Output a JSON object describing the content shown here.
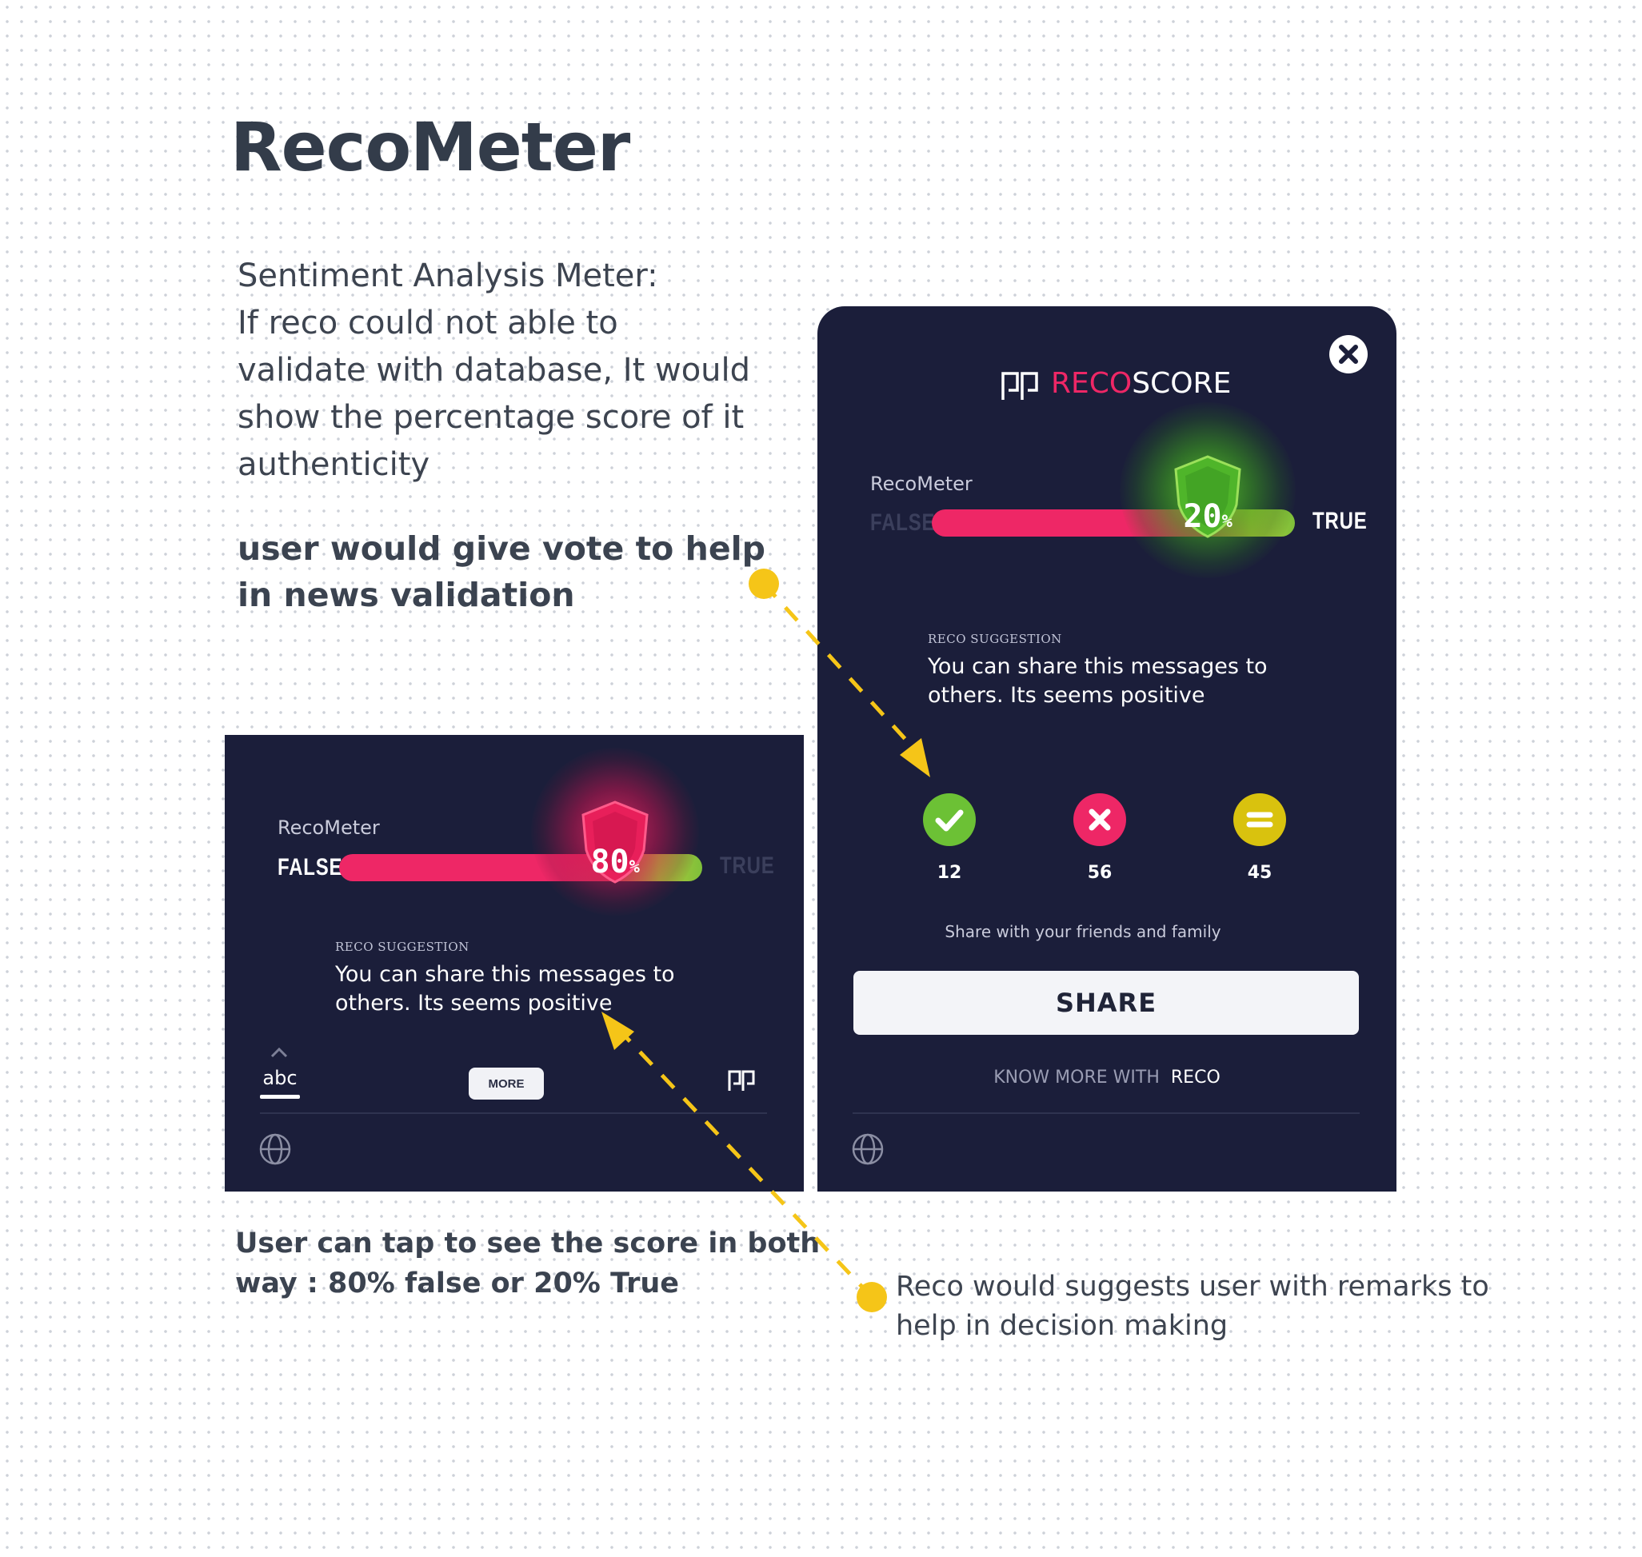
{
  "title": "RecoMeter",
  "description": [
    "Sentiment Analysis  Meter:",
    "If  reco  could not able to",
    "validate with database, It would",
    "show the percentage score of it",
    "authenticity"
  ],
  "vote_note": [
    "user would give vote to help",
    "in news validation"
  ],
  "tap_note": [
    "User can tap to see the score in both",
    "way : 80% false or 20% True"
  ],
  "reco_note": [
    "Reco would suggests user with remarks to",
    "help in decision making"
  ],
  "colors": {
    "panel": "#1b1e3a",
    "pink": "#ee2766",
    "green": "#6cc135",
    "yellow": "#f5c518",
    "annotation": "#f5c518"
  },
  "small_panel": {
    "meter_label": "RecoMeter",
    "false_label": "FALSE",
    "true_label": "TRUE",
    "score_value": "80",
    "score_unit": "%",
    "score_percent": 80,
    "suggestion_title": "RECO SUGGESTION",
    "suggestion_text": [
      "You can share this messages to",
      "others. Its seems positive"
    ],
    "keyboard_label": "abc",
    "more_label": "MORE",
    "icons": [
      "chevron-up-icon",
      "reco-logo-icon",
      "globe-icon"
    ]
  },
  "large_panel": {
    "brand_highlight": "RECO",
    "brand_rest": "SCORE",
    "meter_label": "RecoMeter",
    "false_label": "FALSE",
    "true_label": "TRUE",
    "score_value": "20",
    "score_unit": "%",
    "score_percent": 20,
    "suggestion_title": "RECO SUGGESTION",
    "suggestion_text": [
      "You can share this messages to",
      "others. Its seems positive"
    ],
    "votes": [
      {
        "icon": "check-icon",
        "count": "12",
        "color": "#6cc135"
      },
      {
        "icon": "cross-icon",
        "count": "56",
        "color": "#ee2766"
      },
      {
        "icon": "equals-icon",
        "count": "45",
        "color": "#d9c20e"
      }
    ],
    "share_hint": "Share with your friends and family",
    "share_label": "SHARE",
    "know_more": "KNOW MORE WITH",
    "know_more_brand": "RECO",
    "icons": [
      "close-icon",
      "reco-logo-icon",
      "globe-icon"
    ]
  }
}
